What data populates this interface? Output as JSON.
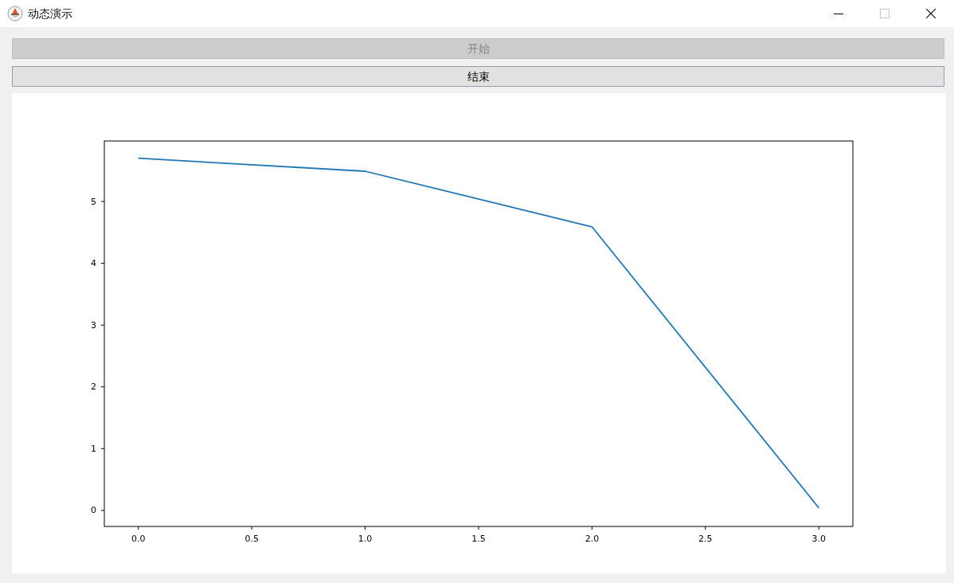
{
  "window": {
    "title": "动态演示",
    "controls": [
      {
        "kind": "minimize",
        "disabled": false
      },
      {
        "kind": "maximize",
        "disabled": true
      },
      {
        "kind": "close",
        "disabled": false
      }
    ]
  },
  "buttons": [
    {
      "label": "开始",
      "disabled": true
    },
    {
      "label": "结束",
      "disabled": false
    }
  ],
  "figure": {
    "chart_data": [
      {
        "type": "line",
        "x": [
          0,
          1,
          2,
          3
        ],
        "values": [
          5.7,
          5.49,
          4.59,
          0.04
        ],
        "color": "#1f77b4",
        "xlim": [
          -0.15,
          3.15
        ],
        "ylim": [
          -0.26,
          5.98
        ],
        "xticks": [
          {
            "value": 0,
            "label": "0.0"
          },
          {
            "value": 0.5,
            "label": "0.5"
          },
          {
            "value": 1,
            "label": "1.0"
          },
          {
            "value": 1.5,
            "label": "1.5"
          },
          {
            "value": 2,
            "label": "2.0"
          },
          {
            "value": 2.5,
            "label": "2.5"
          },
          {
            "value": 3,
            "label": "3.0"
          }
        ],
        "yticks": [
          0,
          1,
          2,
          3,
          4,
          5
        ]
      }
    ]
  }
}
